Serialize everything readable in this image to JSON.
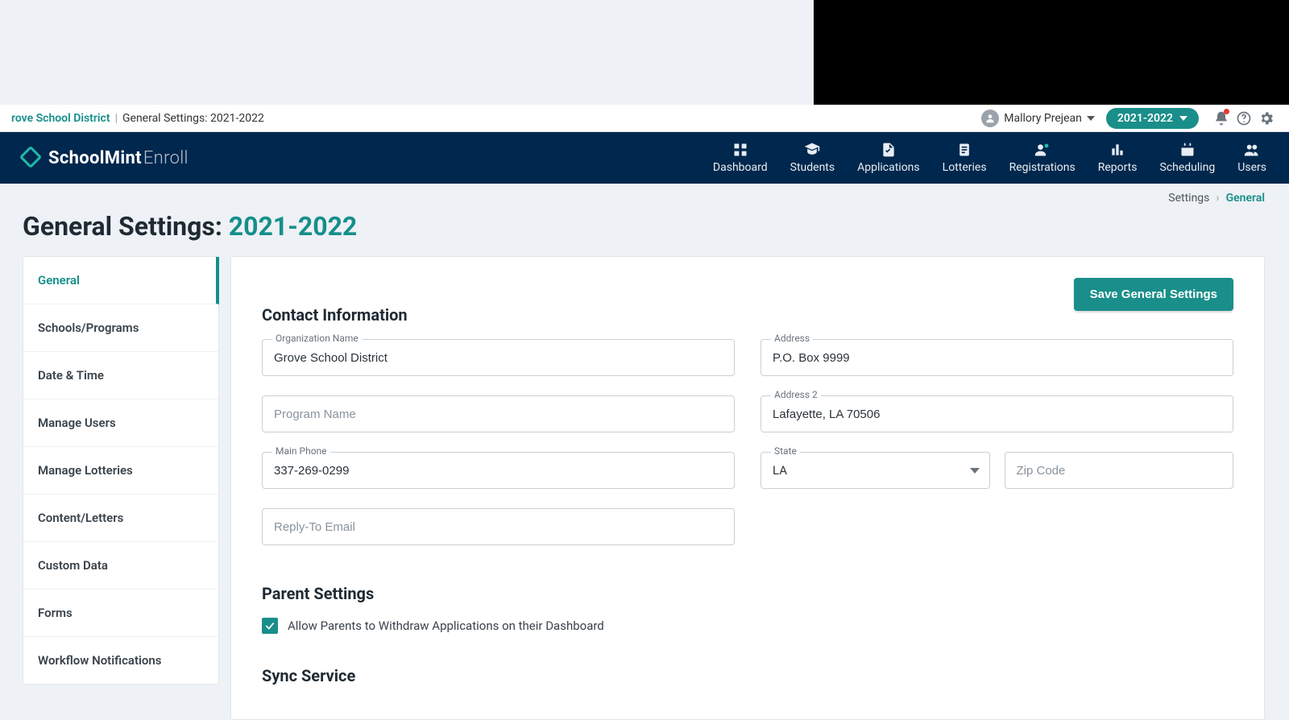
{
  "topbar": {
    "district_fragment": "rove School District",
    "separator": "|",
    "crumb": "General Settings: 2021-2022",
    "user_name": "Mallory Prejean",
    "year_pill": "2021-2022"
  },
  "brand": {
    "name1": "SchoolMint",
    "name2": "Enroll"
  },
  "nav": [
    {
      "label": "Dashboard"
    },
    {
      "label": "Students"
    },
    {
      "label": "Applications"
    },
    {
      "label": "Lotteries"
    },
    {
      "label": "Registrations"
    },
    {
      "label": "Reports"
    },
    {
      "label": "Scheduling"
    },
    {
      "label": "Users"
    }
  ],
  "breadcrumb": {
    "b1": "Settings",
    "b2": "General"
  },
  "page_title_prefix": "General Settings:",
  "page_title_year": "2021-2022",
  "sidebar": {
    "items": [
      {
        "label": "General",
        "active": true
      },
      {
        "label": "Schools/Programs"
      },
      {
        "label": "Date & Time"
      },
      {
        "label": "Manage Users"
      },
      {
        "label": "Manage Lotteries"
      },
      {
        "label": "Content/Letters"
      },
      {
        "label": "Custom Data"
      },
      {
        "label": "Forms"
      },
      {
        "label": "Workflow Notifications"
      }
    ]
  },
  "buttons": {
    "save": "Save General Settings"
  },
  "sections": {
    "contact": "Contact Information",
    "parent": "Parent Settings",
    "sync": "Sync Service"
  },
  "form": {
    "org_label": "Organization Name",
    "org_value": "Grove School District",
    "program_placeholder": "Program Name",
    "phone_label": "Main Phone",
    "phone_value": "337-269-0299",
    "reply_placeholder": "Reply-To Email",
    "address_label": "Address",
    "address_value": "P.O. Box 9999",
    "address2_label": "Address 2",
    "address2_value": "Lafayette, LA 70506",
    "state_label": "State",
    "state_value": "LA",
    "zip_placeholder": "Zip Code"
  },
  "parent_checkbox": {
    "label": "Allow Parents to Withdraw Applications on their Dashboard",
    "checked": true
  },
  "colors": {
    "accent": "#1a8e8a",
    "navy": "#00274d"
  }
}
